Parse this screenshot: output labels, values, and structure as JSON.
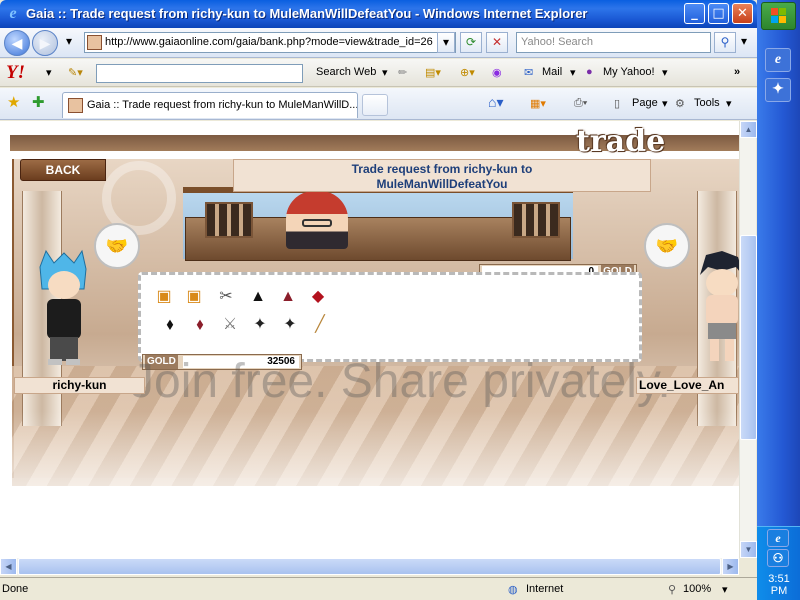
{
  "window": {
    "title": "Gaia :: Trade request from richy-kun to MuleManWillDefeatYou - Windows Internet Explorer",
    "min": "_",
    "max": "□",
    "close": "✕"
  },
  "address_bar": {
    "url": "http://www.gaiaonline.com/gaia/bank.php?mode=view&trade_id=26",
    "search_placeholder": "Yahoo! Search"
  },
  "yahoo_toolbar": {
    "logo": "Y!",
    "search_button": "Search Web",
    "mail": "Mail",
    "my_yahoo": "My Yahoo!",
    "more": "»"
  },
  "tab": {
    "title": "Gaia :: Trade request from richy-kun to MuleManWillD...",
    "page_menu": "Page",
    "tools_menu": "Tools"
  },
  "page": {
    "trade_logo": "trade",
    "back_label": "BACK",
    "request_line1": "Trade request from richy-kun to",
    "request_line2": "MuleManWillDefeatYou",
    "left_user": "richy-kun",
    "right_user": "Love_Love_An",
    "gold_label": "GOLD",
    "gold_offered_right": "0",
    "gold_offered_left": "32506",
    "watermark": "Join free. Share privately."
  },
  "items": [
    {
      "name": "ticket-item",
      "glyph": "🎫"
    },
    {
      "name": "ticket-item",
      "glyph": "🎫"
    },
    {
      "name": "scissors-item",
      "glyph": "✂"
    },
    {
      "name": "black-skirt-item",
      "glyph": "▲"
    },
    {
      "name": "red-skirt-item",
      "glyph": "▲"
    },
    {
      "name": "red-hat-item",
      "glyph": "◆"
    },
    {
      "name": "black-tie-item",
      "glyph": "⬧"
    },
    {
      "name": "red-tie-item",
      "glyph": "⬧"
    },
    {
      "name": "sword-item",
      "glyph": "⚔"
    },
    {
      "name": "shuriken-item",
      "glyph": "✦"
    },
    {
      "name": "shuriken-item",
      "glyph": "✦"
    },
    {
      "name": "bat-item",
      "glyph": "╱"
    }
  ],
  "status_bar": {
    "status": "Done",
    "zone": "Internet",
    "zoom": "100%"
  },
  "taskbar": {
    "clock": "3:51 PM"
  },
  "colors": {
    "accent": "#2459D4",
    "link": "#1E3F7A",
    "wood": "#8B5A32"
  }
}
